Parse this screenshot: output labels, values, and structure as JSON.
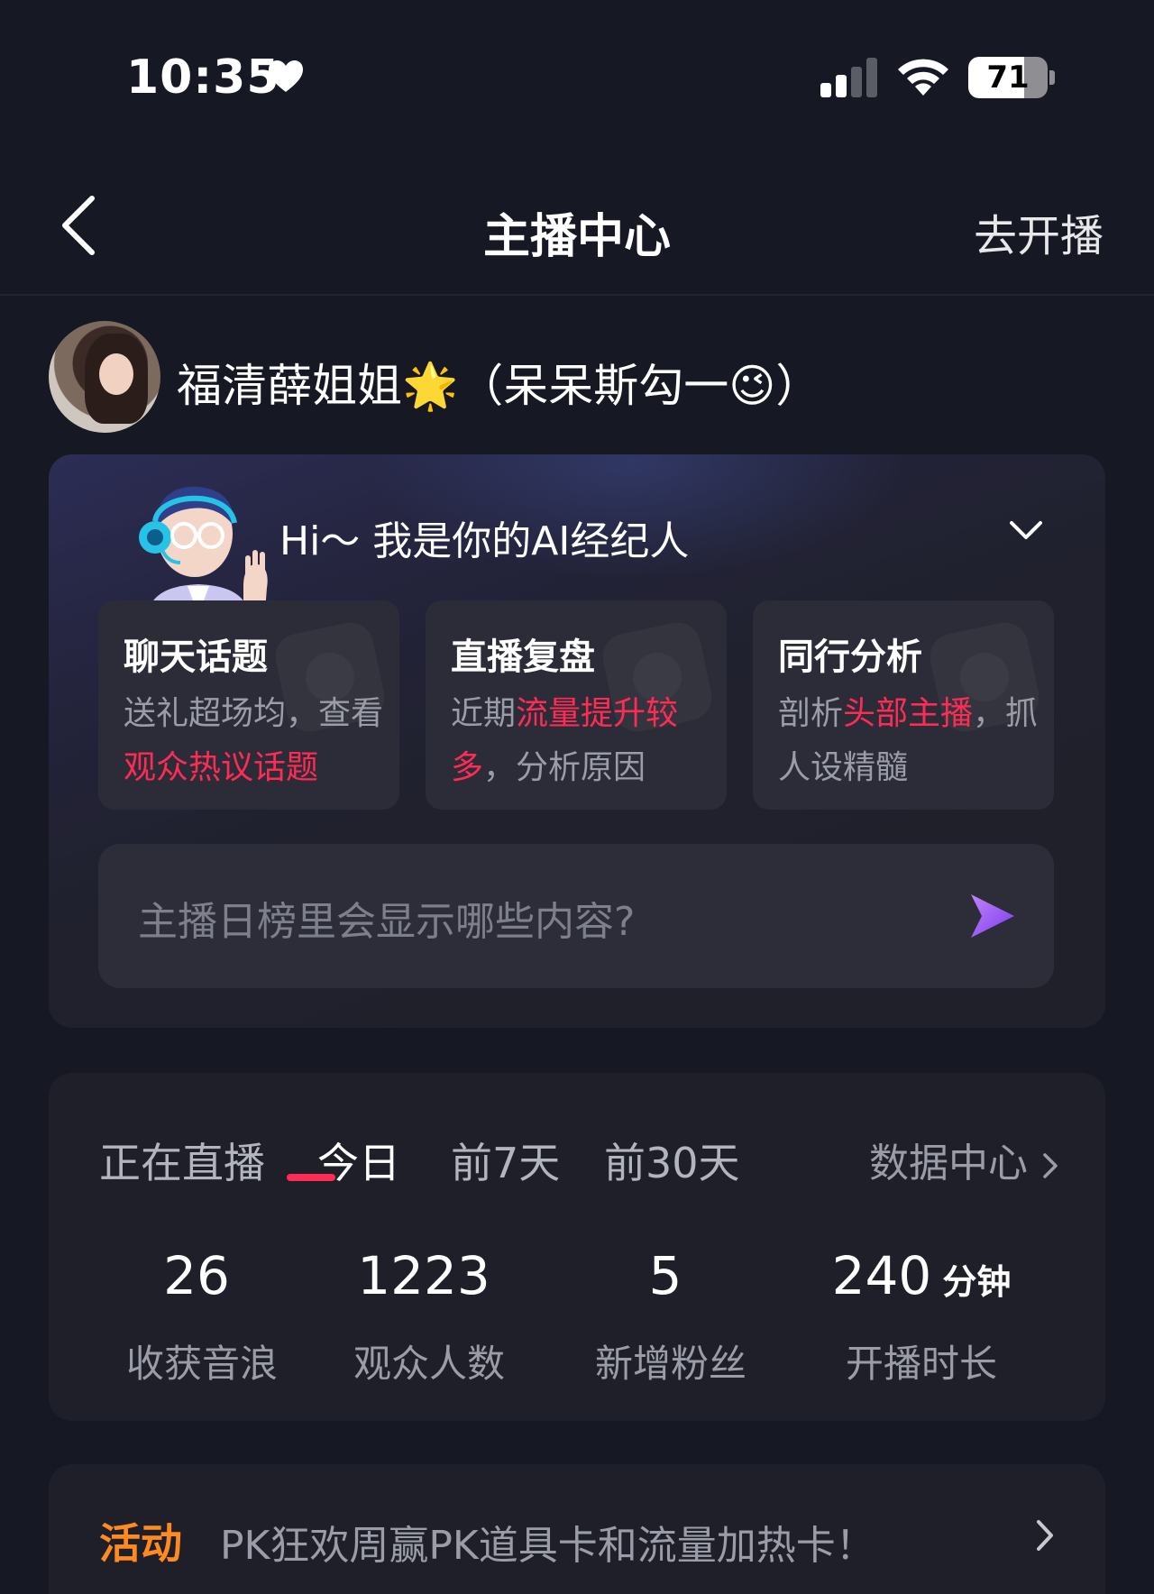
{
  "status_bar": {
    "time": "10:35",
    "battery": "71",
    "battery_level": 0.71,
    "icons": [
      "heart-icon",
      "cellular-signal-icon",
      "wifi-icon",
      "battery-icon"
    ]
  },
  "nav": {
    "title": "主播中心",
    "go_live": "去开播",
    "back_icon": "chevron-left-icon"
  },
  "profile": {
    "name": "福清薛姐姐🌟（呆呆斯勾一😉）"
  },
  "ai_agent": {
    "greeting": "Hi～ 我是你的AI经纪人",
    "cards": [
      {
        "title": "聊天话题",
        "desc_parts": [
          "送礼超场均，查看",
          "观众热议话题",
          ""
        ]
      },
      {
        "title": "直播复盘",
        "desc_parts": [
          "近期",
          "流量提升较多",
          "，分析原因"
        ]
      },
      {
        "title": "同行分析",
        "desc_parts": [
          "剖析",
          "头部主播",
          "，抓人设精髓"
        ]
      }
    ],
    "input_placeholder": "主播日榜里会显示哪些内容?",
    "colors": {
      "highlight": "#fe2c55",
      "send": "#a855f7"
    }
  },
  "stats": {
    "tabs": [
      "正在直播",
      "今日",
      "前7天",
      "前30天"
    ],
    "active_tab": "今日",
    "data_center": "数据中心",
    "items": [
      {
        "value": "26",
        "unit": "",
        "label": "收获音浪"
      },
      {
        "value": "1223",
        "unit": "",
        "label": "观众人数"
      },
      {
        "value": "5",
        "unit": "",
        "label": "新增粉丝"
      },
      {
        "value": "240",
        "unit": "分钟",
        "label": "开播时长"
      }
    ]
  },
  "activity": {
    "tag": "活动",
    "text": "PK狂欢周赢PK道具卡和流量加热卡！",
    "tag_color": "#ff8a1f"
  }
}
